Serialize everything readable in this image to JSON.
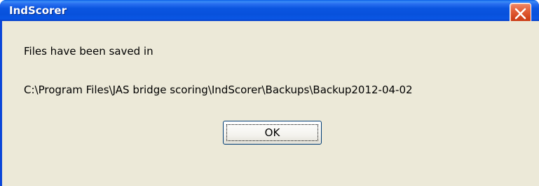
{
  "window": {
    "title": "IndScorer",
    "close_icon": "close-x-icon",
    "colors": {
      "titlebar": "#0a55e0",
      "close_button": "#d2441c",
      "client_background": "#ece9d8"
    }
  },
  "message": {
    "line1": "Files have been saved in",
    "line2": "C:\\Program Files\\JAS bridge scoring\\IndScorer\\Backups\\Backup2012-04-02"
  },
  "buttons": {
    "ok_label": "OK"
  }
}
